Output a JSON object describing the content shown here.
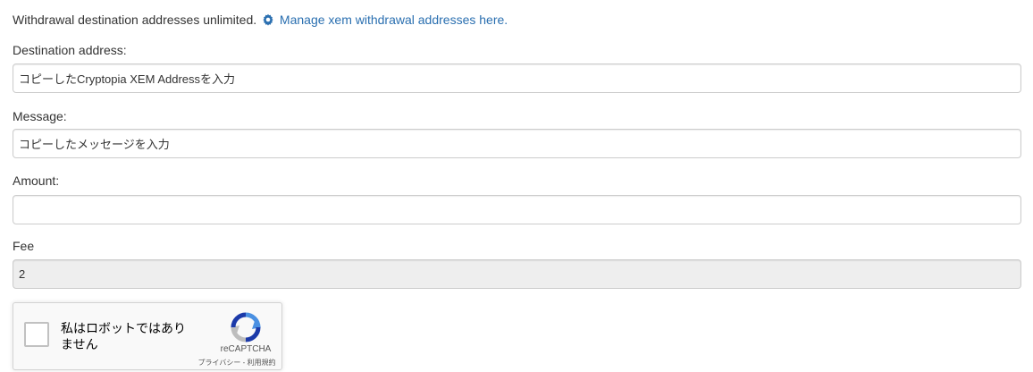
{
  "notice": {
    "text": "Withdrawal destination addresses unlimited.",
    "link_icon": "gear-icon",
    "link_text": "Manage xem withdrawal addresses here.",
    "link_color": "#2a6fb0"
  },
  "form": {
    "destination": {
      "label": "Destination address:",
      "value": "コピーしたCryptopia XEM Addressを入力"
    },
    "message": {
      "label": "Message:",
      "value": "コピーしたメッセージを入力"
    },
    "amount": {
      "label": "Amount:",
      "value": ""
    },
    "fee": {
      "label": "Fee",
      "value": "2"
    }
  },
  "captcha": {
    "checkbox_label": "私はロボットではありません",
    "brand": "reCAPTCHA",
    "privacy_link": "プライバシー",
    "separator": " - ",
    "terms_link": "利用規約",
    "logo_icon": "recaptcha-logo-icon"
  }
}
